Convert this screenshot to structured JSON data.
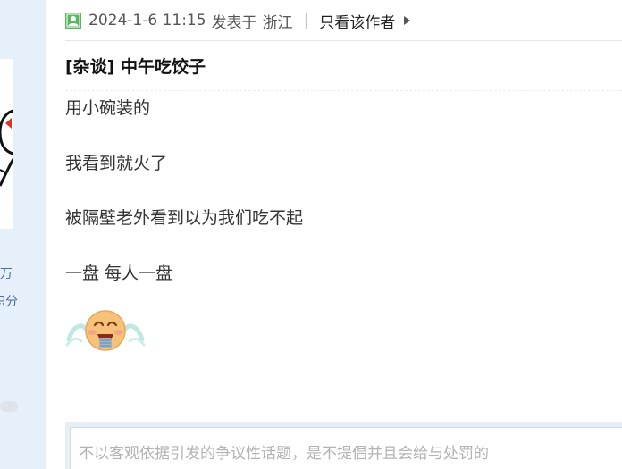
{
  "sidebar": {
    "stat_wan": "万",
    "stat_points": "积分"
  },
  "post": {
    "timestamp": "2024-1-6 11:15",
    "posted_in_label": "发表于",
    "location": "浙江",
    "separator": "|",
    "only_author_label": "只看该作者",
    "title": "[杂谈] 中午吃饺子",
    "lines": [
      "用小碗装的",
      "我看到就火了",
      "被隔壁老外看到以为我们吃不起",
      "一盘 每人一盘"
    ],
    "emoji_icon": "crying-laughing-emoji-icon"
  },
  "reply": {
    "placeholder": "不以客观依据引发的争议性话题，是不提倡并且会给与处罚的"
  },
  "colors": {
    "sidebar_bg": "#e6f0fb",
    "user_icon_green": "#5cb85c",
    "link_blue": "#4a6fa0"
  }
}
